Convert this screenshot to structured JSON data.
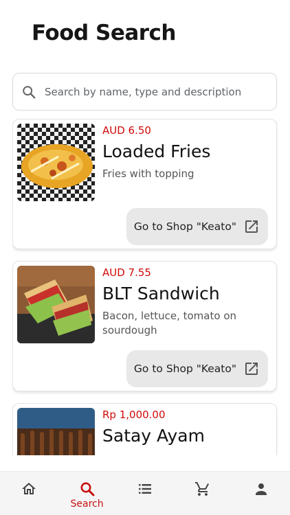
{
  "page": {
    "title": "Food Search"
  },
  "search": {
    "placeholder": "Search by name, type and description"
  },
  "results": [
    {
      "price": "AUD 6.50",
      "name": "Loaded Fries",
      "description": "Fries with topping",
      "shop_button": "Go to Shop \"Keato\""
    },
    {
      "price": "AUD 7.55",
      "name": "BLT Sandwich",
      "description": "Bacon, lettuce, tomato on sourdough",
      "shop_button": "Go to Shop \"Keato\""
    },
    {
      "price": "Rp 1,000.00",
      "name": "Satay Ayam",
      "description": "",
      "shop_button": ""
    }
  ],
  "nav": {
    "active": "search",
    "items": [
      {
        "icon": "home-icon",
        "label": ""
      },
      {
        "icon": "search-icon",
        "label": "Search"
      },
      {
        "icon": "list-icon",
        "label": ""
      },
      {
        "icon": "cart-icon",
        "label": ""
      },
      {
        "icon": "person-icon",
        "label": ""
      }
    ]
  },
  "colors": {
    "price": "#d10a0a",
    "active_nav": "#c60f0f",
    "button_bg": "#e8e8e8"
  }
}
